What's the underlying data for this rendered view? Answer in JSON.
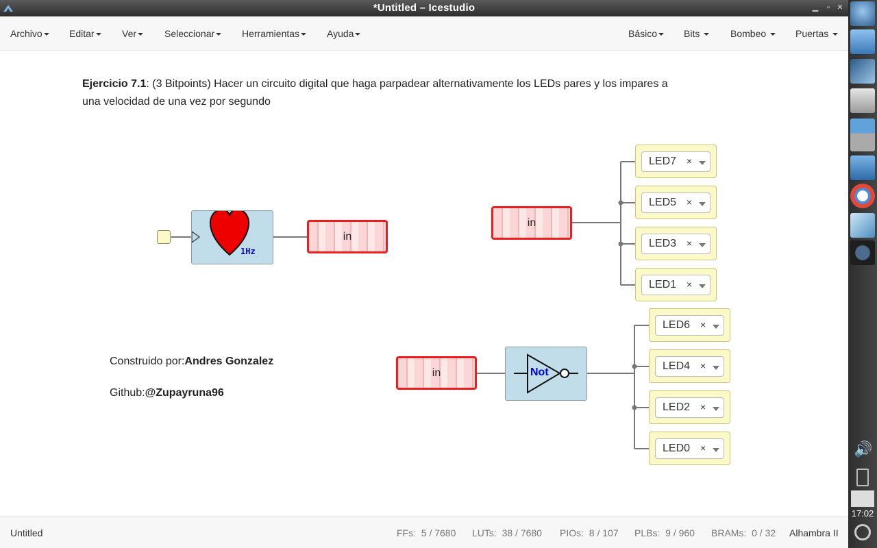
{
  "window": {
    "title": "*Untitled – Icestudio"
  },
  "menu": {
    "left": [
      "Archivo",
      "Editar",
      "Ver",
      "Seleccionar",
      "Herramientas",
      "Ayuda"
    ],
    "right": [
      "Básico",
      "Bits",
      "Bombeo",
      "Puertas"
    ]
  },
  "exercise": {
    "title": "Ejercicio 7.1",
    "text": ": (3 Bitpoints) Hacer un circuito digital que haga parpadear alternativamente los LEDs pares y los impares a una velocidad de una vez por segundo"
  },
  "blocks": {
    "heart_freq": "1Hz",
    "not_label": "Not",
    "in_labels": [
      "in",
      "in",
      "in"
    ]
  },
  "leds_odd": [
    "LED7",
    "LED5",
    "LED3",
    "LED1"
  ],
  "leds_even": [
    "LED6",
    "LED4",
    "LED2",
    "LED0"
  ],
  "led_clear": "×",
  "credits": {
    "built_prefix": "Construido por:",
    "built_name": "Andres Gonzalez",
    "github_prefix": "Github:",
    "github_user": "@Zupayruna96"
  },
  "status": {
    "project": "Untitled",
    "ffs_label": "FFs:",
    "ffs": "5 / 7680",
    "luts_label": "LUTs:",
    "luts": "38 / 7680",
    "pios_label": "PIOs:",
    "pios": "8 / 107",
    "plbs_label": "PLBs:",
    "plbs": "9 / 960",
    "brams_label": "BRAMs:",
    "brams": "0 / 32",
    "board": "Alhambra II"
  },
  "clock": "17:02",
  "icons": [
    "icestudio-logo-icon",
    "minimize-icon",
    "restore-icon",
    "close-icon",
    "heart-icon",
    "not-gate-icon"
  ],
  "colors": {
    "accent_red": "#ee1c1c",
    "block_blue": "#c1dde9",
    "led_yellow": "#fbf9c8",
    "not_text": "#0000dd"
  }
}
